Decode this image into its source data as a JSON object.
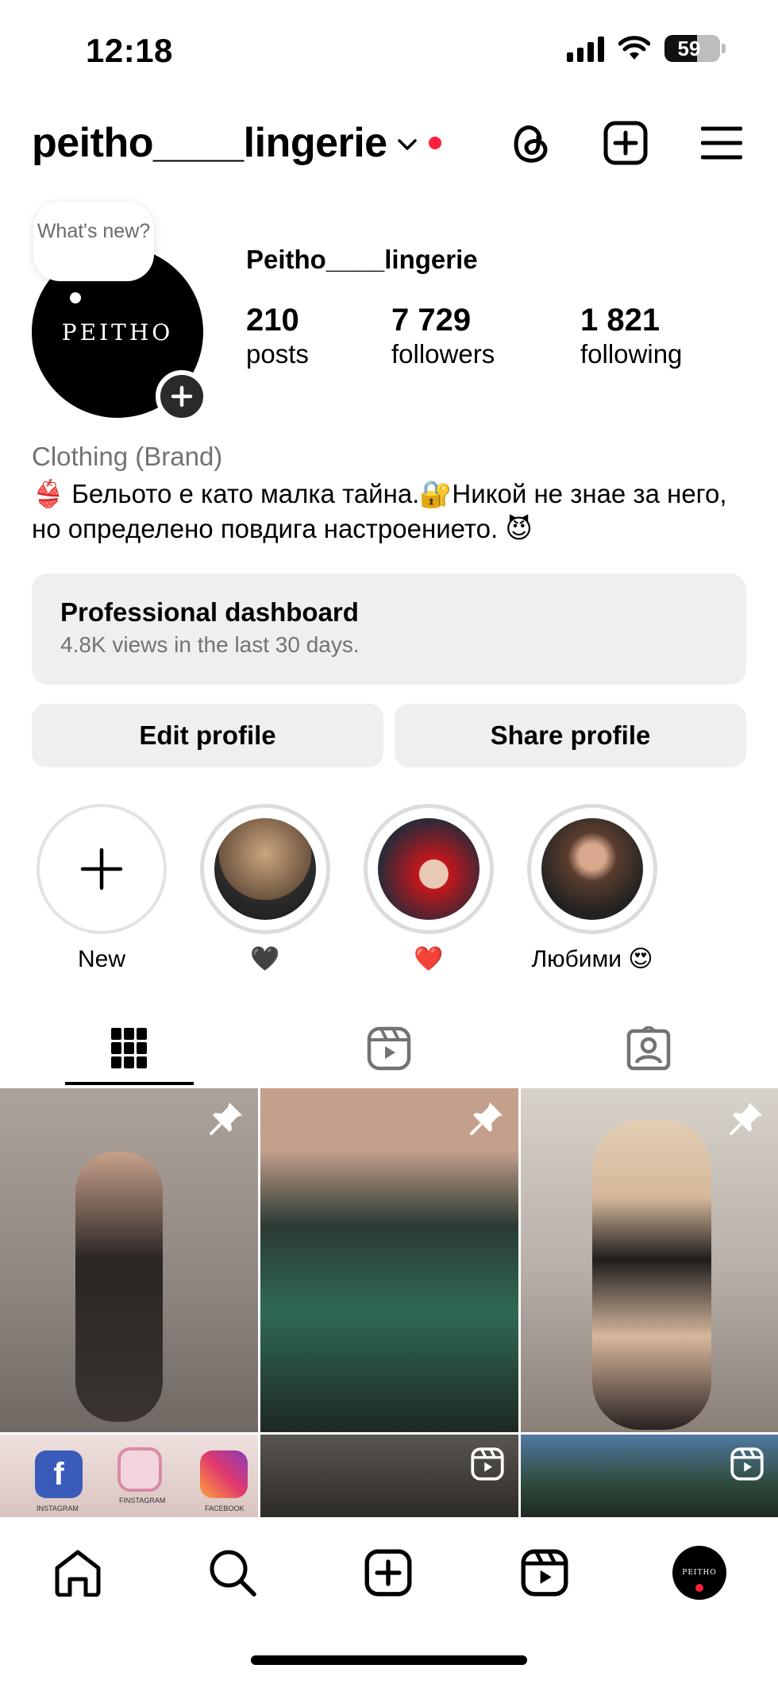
{
  "status_bar": {
    "time": "12:18",
    "battery": "59",
    "battery_level": 0.59
  },
  "header": {
    "username": "peitho____lingerie"
  },
  "profile": {
    "note": "What's new?",
    "avatar_text": "PEITHO",
    "display_name": "Peitho____lingerie",
    "stats": [
      {
        "value": "210",
        "label": "posts"
      },
      {
        "value": "7 729",
        "label": "followers"
      },
      {
        "value": "1 821",
        "label": "following"
      }
    ],
    "category": "Clothing (Brand)",
    "bio": "👙 Бельото е като малка тайна.🔐Никой не знае за него, но определено повдига настроението. 😈"
  },
  "dashboard": {
    "title": "Professional dashboard",
    "subtitle": "4.8K views in the last 30 days."
  },
  "buttons": {
    "edit": "Edit profile",
    "share": "Share profile"
  },
  "highlights": [
    {
      "label": "New"
    },
    {
      "label": "🖤"
    },
    {
      "label": "❤️"
    },
    {
      "label": "Любими 😍"
    }
  ],
  "grid": {
    "posts": [
      {
        "kind": "pinned",
        "thumb_color": "#9a9089"
      },
      {
        "kind": "pinned",
        "thumb_color": "#4a5b52"
      },
      {
        "kind": "pinned",
        "thumb_color": "#b8b2ad"
      },
      {
        "kind": "reel",
        "thumb_color": "#e7d7d4",
        "labels": [
          "INSTAGRAM",
          "FINSTAGRAM",
          "FACEBOOK"
        ]
      },
      {
        "kind": "reel",
        "thumb_color": "#3d3a37"
      },
      {
        "kind": "reel",
        "thumb_color": "#2f4a3a"
      }
    ]
  },
  "colors": {
    "accent_red": "#ff1f3d",
    "button_bg": "#efeff2",
    "muted_text": "#737373"
  },
  "icons": [
    "threads-icon",
    "create-post-icon",
    "menu-icon",
    "grid-icon",
    "reels-icon",
    "tagged-icon",
    "home-icon",
    "search-icon",
    "reels-nav-icon"
  ]
}
